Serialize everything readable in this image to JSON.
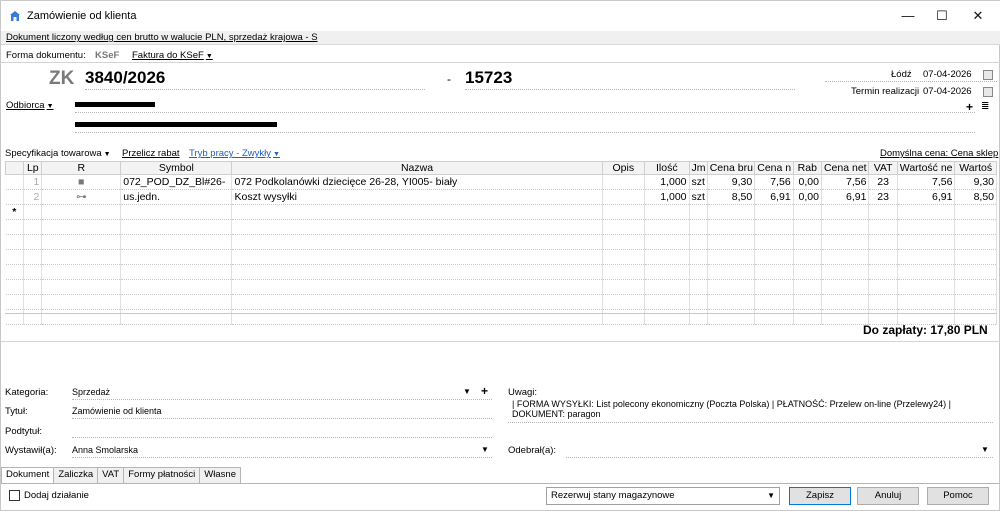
{
  "window": {
    "title": "Zamówienie od klienta",
    "controls": {
      "minimize": "—",
      "maximize": "☐",
      "close": "✕"
    }
  },
  "info_text": "Dokument liczony według cen brutto w walucie PLN, sprzedaż krajowa - S",
  "form_row": {
    "label": "Forma dokumentu:",
    "ksef": "KSeF",
    "invoice": "Faktura do KSeF"
  },
  "doc": {
    "prefix": "ZK",
    "number": "3840/2026",
    "separator": "-",
    "code": "15723"
  },
  "place_date": {
    "place": "Łódź",
    "date": "07-04-2026"
  },
  "realization": {
    "label": "Termin realizacji",
    "date": "07-04-2026"
  },
  "recipient": {
    "label": "Odbiorca"
  },
  "spec_bar": {
    "spec": "Specyfikacja towarowa",
    "recalc": "Przelicz rabat",
    "mode": "Tryb pracy - Zwykły",
    "default_price": "Domyślna cena: Cena sklep"
  },
  "table": {
    "headers": [
      "Lp",
      "R",
      "Symbol",
      "Nazwa",
      "Opis",
      "Ilość",
      "Jm",
      "Cena bru",
      "Cena n",
      "Rab",
      "Cena net",
      "VAT",
      "Wartość ne",
      "Wartoś"
    ],
    "rows": [
      {
        "lp": "1",
        "r": "■",
        "symbol": "072_POD_DZ_Bl#26-",
        "nazwa": "072 Podkolanówki dziecięce 26-28, YI005- biały",
        "opis": "",
        "ilosc": "1,000",
        "jm": "szt",
        "cena_bru": "9,30",
        "cena_n": "7,56",
        "rab": "0,00",
        "cena_net": "7,56",
        "vat": "23",
        "wartosc_ne": "7,56",
        "wartosc": "9,30"
      },
      {
        "lp": "2",
        "r": "⊶",
        "symbol": "us.jedn.",
        "nazwa": "Koszt wysyłki",
        "opis": "",
        "ilosc": "1,000",
        "jm": "szt",
        "cena_bru": "8,50",
        "cena_n": "6,91",
        "rab": "0,00",
        "cena_net": "6,91",
        "vat": "23",
        "wartosc_ne": "6,91",
        "wartosc": "8,50"
      }
    ],
    "new_row_marker": "*"
  },
  "total": "Do zapłaty: 17,80 PLN",
  "fields": {
    "kategoria_label": "Kategoria:",
    "kategoria_value": "Sprzedaż",
    "tytul_label": "Tytuł:",
    "tytul_value": "Zamówienie od klienta",
    "podtytul_label": "Podtytuł:",
    "wystawil_label": "Wystawił(a):",
    "wystawil_value": "Anna Smolarska",
    "uwagi_label": "Uwagi:",
    "uwagi_line1": "| FORMA WYSYŁKI: List polecony ekonomiczny (Poczta Polska) | PŁATNOŚĆ: Przelew on-line (Przelewy24) |",
    "uwagi_line2": "DOKUMENT: paragon",
    "odebral_label": "Odebrał(a):"
  },
  "tabs": [
    "Dokument",
    "Zaliczka",
    "VAT",
    "Formy płatności",
    "Własne"
  ],
  "footer": {
    "add_action": "Dodaj działanie",
    "reserve": "Rezerwuj stany magazynowe",
    "save": "Zapisz",
    "cancel": "Anuluj",
    "help": "Pomoc"
  }
}
